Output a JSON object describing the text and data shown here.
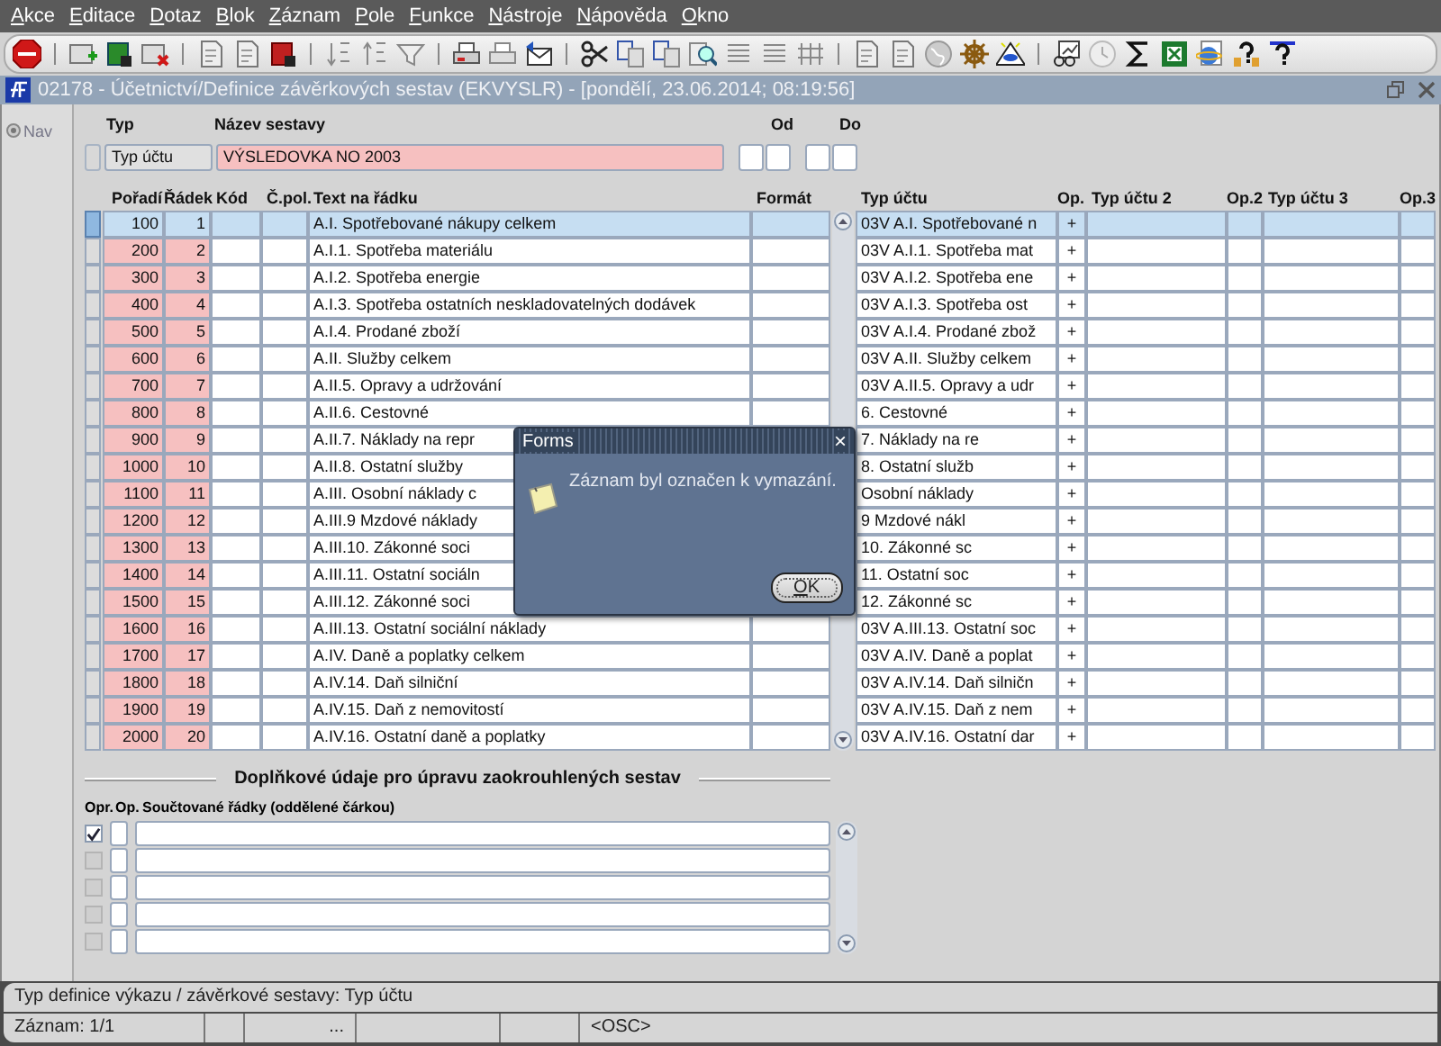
{
  "menu": [
    "Akce",
    "Editace",
    "Dotaz",
    "Blok",
    "Záznam",
    "Pole",
    "Funkce",
    "Nástroje",
    "Nápověda",
    "Okno"
  ],
  "window": {
    "title": "02178 - Účetnictví/Definice závěrkových sestav (EKVYSLR) - [pondělí, 23.06.2014; 08:19:56]"
  },
  "nav": {
    "label": "Nav"
  },
  "header": {
    "type_label": "Typ",
    "name_label": "Název sestavy",
    "from_label": "Od",
    "to_label": "Do",
    "type_value": "Typ účtu",
    "name_value": "VÝSLEDOVKA NO 2003"
  },
  "table": {
    "columns": [
      "Pořadí",
      "Řádek",
      "Kód",
      "Č.pol.",
      "Text na řádku",
      "Formát",
      "Typ účtu",
      "Op.",
      "Typ účtu 2",
      "Op.2",
      "Typ účtu 3",
      "Op.3"
    ],
    "rows": [
      {
        "order": "100",
        "line": "1",
        "text": "A.I. Spotřebované nákupy celkem",
        "account": "03V A.I. Spotřebované n",
        "op": "+",
        "selected": true
      },
      {
        "order": "200",
        "line": "2",
        "text": "A.I.1. Spotřeba materiálu",
        "account": "03V A.I.1. Spotřeba mat",
        "op": "+",
        "selected": false
      },
      {
        "order": "300",
        "line": "3",
        "text": "A.I.2. Spotřeba energie",
        "account": "03V A.I.2. Spotřeba ene",
        "op": "+",
        "selected": false
      },
      {
        "order": "400",
        "line": "4",
        "text": "A.I.3. Spotřeba ostatních neskladovatelných dodávek",
        "account": "03V A.I.3. Spotřeba ost",
        "op": "+",
        "selected": false
      },
      {
        "order": "500",
        "line": "5",
        "text": "A.I.4. Prodané zboží",
        "account": "03V A.I.4. Prodané zbož",
        "op": "+",
        "selected": false
      },
      {
        "order": "600",
        "line": "6",
        "text": "A.II. Služby celkem",
        "account": "03V A.II. Služby celkem",
        "op": "+",
        "selected": false
      },
      {
        "order": "700",
        "line": "7",
        "text": "A.II.5. Opravy a udržování",
        "account": "03V A.II.5. Opravy a udr",
        "op": "+",
        "selected": false
      },
      {
        "order": "800",
        "line": "8",
        "text": "A.II.6. Cestovné",
        "account": "6. Cestovné",
        "op": "+",
        "selected": false
      },
      {
        "order": "900",
        "line": "9",
        "text": "A.II.7. Náklady na repr",
        "account": "7. Náklady na re",
        "op": "+",
        "selected": false
      },
      {
        "order": "1000",
        "line": "10",
        "text": "A.II.8. Ostatní služby",
        "account": "8. Ostatní služb",
        "op": "+",
        "selected": false
      },
      {
        "order": "1100",
        "line": "11",
        "text": "A.III. Osobní náklady c",
        "account": "Osobní náklady",
        "op": "+",
        "selected": false
      },
      {
        "order": "1200",
        "line": "12",
        "text": "A.III.9 Mzdové náklady",
        "account": "9 Mzdové nákl",
        "op": "+",
        "selected": false
      },
      {
        "order": "1300",
        "line": "13",
        "text": "A.III.10. Zákonné soci",
        "account": "10. Zákonné sc",
        "op": "+",
        "selected": false
      },
      {
        "order": "1400",
        "line": "14",
        "text": "A.III.11. Ostatní sociáln",
        "account": "11. Ostatní soc",
        "op": "+",
        "selected": false
      },
      {
        "order": "1500",
        "line": "15",
        "text": "A.III.12. Zákonné soci",
        "account": "12. Zákonné sc",
        "op": "+",
        "selected": false
      },
      {
        "order": "1600",
        "line": "16",
        "text": "A.III.13. Ostatní sociální náklady",
        "account": "03V A.III.13. Ostatní soc",
        "op": "+",
        "selected": false
      },
      {
        "order": "1700",
        "line": "17",
        "text": "A.IV. Daně a poplatky celkem",
        "account": "03V A.IV. Daně a poplat",
        "op": "+",
        "selected": false
      },
      {
        "order": "1800",
        "line": "18",
        "text": "A.IV.14. Daň silniční",
        "account": "03V A.IV.14. Daň silničn",
        "op": "+",
        "selected": false
      },
      {
        "order": "1900",
        "line": "19",
        "text": "A.IV.15. Daň z nemovitostí",
        "account": "03V A.IV.15. Daň z nem",
        "op": "+",
        "selected": false
      },
      {
        "order": "2000",
        "line": "20",
        "text": "A.IV.16. Ostatní daně a poplatky",
        "account": "03V A.IV.16. Ostatní dar",
        "op": "+",
        "selected": false
      }
    ]
  },
  "rounding": {
    "title": "Doplňkové údaje pro úpravu zaokrouhlených sestav",
    "columns": [
      "Opr.",
      "Op.",
      "Součtované řádky (oddělené čárkou)"
    ],
    "rows": [
      {
        "checked": true,
        "disabled": false
      },
      {
        "checked": false,
        "disabled": true
      },
      {
        "checked": false,
        "disabled": true
      },
      {
        "checked": false,
        "disabled": true
      },
      {
        "checked": false,
        "disabled": true
      }
    ]
  },
  "dialog": {
    "title": "Forms",
    "close": "×",
    "message": "Záznam byl označen k vymazání.",
    "button": "OK"
  },
  "status": {
    "message": "Typ definice výkazu / závěrkové sestavy: Typ účtu",
    "segments": [
      {
        "text": "Záznam: 1/1"
      },
      {
        "text": "..."
      },
      {
        "text": "<OSC>"
      }
    ]
  }
}
